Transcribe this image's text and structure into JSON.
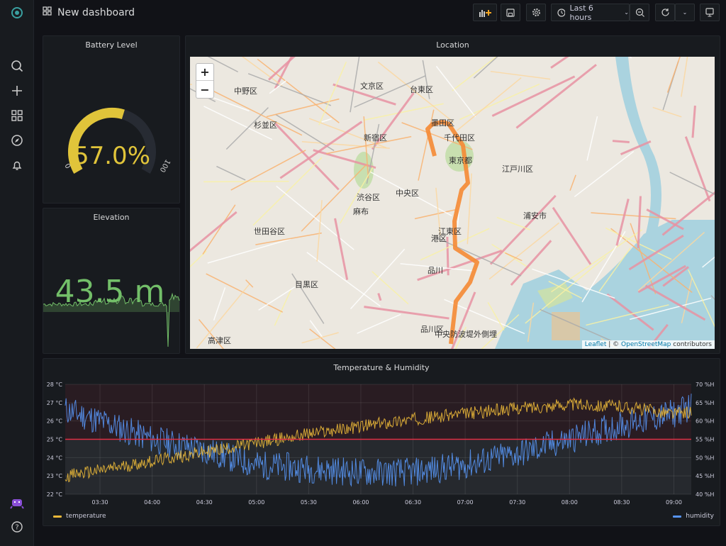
{
  "colors": {
    "accent_yellow": "#e0c43a",
    "green": "#73bf69",
    "temperature": "#eab839",
    "humidity": "#5794f2",
    "threshold": "#e02f44",
    "route": "#f58a34"
  },
  "sidebar": {
    "items": [
      {
        "icon": "grafana-logo-icon"
      },
      {
        "icon": "search-icon"
      },
      {
        "icon": "plus-icon"
      },
      {
        "icon": "dashboards-grid-icon"
      },
      {
        "icon": "compass-icon"
      },
      {
        "icon": "bell-icon"
      },
      {
        "icon": "user-avatar-icon"
      },
      {
        "icon": "help-icon"
      }
    ]
  },
  "header": {
    "title": "New dashboard",
    "time_range": "Last 6 hours"
  },
  "battery": {
    "title": "Battery Level",
    "value_text": "57.0%",
    "value": 57,
    "min_label": "0",
    "max_label": "100",
    "min": 0,
    "max": 100
  },
  "elevation": {
    "title": "Elevation",
    "value_text": "43.5 m"
  },
  "location": {
    "title": "Location",
    "zoom_in": "+",
    "zoom_out": "−",
    "attribution_leaflet": "Leaflet",
    "attribution_sep": " | © ",
    "attribution_osm": "OpenStreetMap",
    "attribution_suffix": " contributors",
    "labels": [
      "中野区",
      "文京区",
      "台東区",
      "杉並区",
      "新宿区",
      "千代田区",
      "墨田区",
      "東京都",
      "江戸川区",
      "渋谷区",
      "中央区",
      "麻布",
      "世田谷区",
      "港区",
      "江東区",
      "浦安市",
      "品川",
      "目黒区",
      "品川区",
      "中央防波堤外側埋",
      "高津区"
    ]
  },
  "chart_data": {
    "type": "line",
    "title": "Temperature & Humidity",
    "x_ticks": [
      "03:30",
      "04:00",
      "04:30",
      "05:00",
      "05:30",
      "06:00",
      "06:30",
      "07:00",
      "07:30",
      "08:00",
      "08:30",
      "09:00"
    ],
    "xlim": [
      "03:10",
      "09:10"
    ],
    "y_left": {
      "ticks": [
        "22 °C",
        "23 °C",
        "24 °C",
        "25 °C",
        "26 °C",
        "27 °C",
        "28 °C"
      ],
      "range": [
        22,
        28
      ]
    },
    "y_right": {
      "ticks": [
        "40 %H",
        "45 %H",
        "50 %H",
        "55 %H",
        "60 %H",
        "65 %H",
        "70 %H"
      ],
      "range": [
        40,
        70
      ]
    },
    "threshold": {
      "value": 25,
      "axis": "left"
    },
    "grid": true,
    "legend_placement": "bottom",
    "series": [
      {
        "name": "temperature",
        "axis": "left",
        "x": [
          "03:10",
          "03:30",
          "04:00",
          "04:30",
          "05:00",
          "05:30",
          "06:00",
          "06:30",
          "07:00",
          "07:30",
          "08:00",
          "08:30",
          "09:00",
          "09:10"
        ],
        "values": [
          23.0,
          23.3,
          23.8,
          24.3,
          24.8,
          25.3,
          25.7,
          26.1,
          26.4,
          26.7,
          26.9,
          26.8,
          26.4,
          26.5
        ]
      },
      {
        "name": "humidity",
        "axis": "right",
        "x": [
          "03:10",
          "03:30",
          "04:00",
          "04:30",
          "05:00",
          "05:30",
          "06:00",
          "06:30",
          "07:00",
          "07:30",
          "08:00",
          "08:30",
          "09:00",
          "09:10"
        ],
        "values": [
          63,
          60,
          55,
          52,
          48,
          47,
          46,
          46,
          48,
          51,
          55,
          59,
          62,
          64
        ]
      }
    ]
  }
}
